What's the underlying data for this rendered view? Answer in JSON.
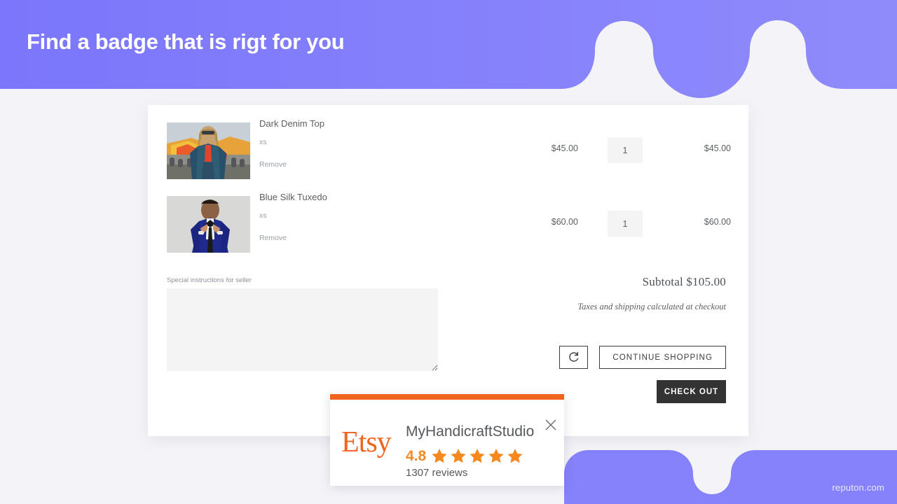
{
  "header": {
    "title": "Find a badge that is rigt for you",
    "gradient_from": "#7b76fb",
    "gradient_to": "#8e8afb"
  },
  "page": {
    "background": "#f4f4f8",
    "watermark": "reputon.com"
  },
  "cart": {
    "items": [
      {
        "title": "Dark Denim Top",
        "variant": "xs",
        "remove_label": "Remove",
        "price": "$45.00",
        "quantity": "1",
        "line_total": "$45.00",
        "image_alt": "woman-in-denim-jacket-at-fair"
      },
      {
        "title": "Blue Silk Tuxedo",
        "variant": "xs",
        "remove_label": "Remove",
        "price": "$60.00",
        "quantity": "1",
        "line_total": "$60.00",
        "image_alt": "man-in-blue-tuxedo"
      }
    ],
    "instructions_label": "Special instructions for seller",
    "instructions_value": "",
    "instructions_placeholder": "",
    "subtotal_label": "Subtotal $105.00",
    "tax_note": "Taxes and shipping calculated at checkout",
    "refresh_icon": "refresh-icon",
    "continue_label": "CONTINUE SHOPPING",
    "checkout_label": "CHECK OUT"
  },
  "badge": {
    "accent_color": "#f1641e",
    "platform": "Etsy",
    "shop_name": "MyHandicraftStudio",
    "rating": "4.8",
    "stars": 5,
    "star_color": "#f5891f",
    "reviews": "1307 reviews",
    "close_icon": "close-icon"
  }
}
